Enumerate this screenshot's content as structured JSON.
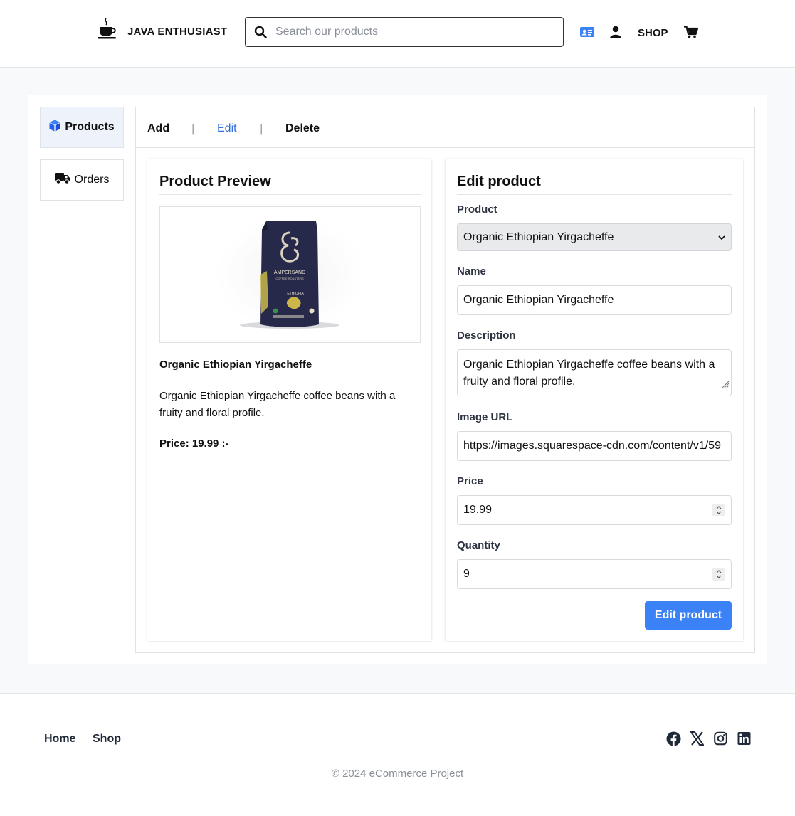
{
  "header": {
    "brand": "JAVA ENTHUSIAST",
    "search_placeholder": "Search our products",
    "shop_label": "SHOP",
    "icons": [
      "coffee-cup-icon",
      "search-icon",
      "id-card-icon",
      "user-icon",
      "cart-icon"
    ],
    "accent_color": "#3b82f6"
  },
  "sidebar": {
    "items": [
      {
        "label": "Products",
        "icon": "box-icon",
        "active": true
      },
      {
        "label": "Orders",
        "icon": "truck-icon",
        "active": false
      }
    ]
  },
  "tabs": [
    {
      "label": "Add",
      "active": false
    },
    {
      "label": "Edit",
      "active": true
    },
    {
      "label": "Delete",
      "active": false
    }
  ],
  "tab_separator": "|",
  "preview": {
    "title": "Product Preview",
    "name": "Organic Ethiopian Yirgacheffe",
    "description": "Organic Ethiopian Yirgacheffe coffee beans with a fruity and floral profile.",
    "price_text": "Price: 19.99 :-",
    "image_brand": "AMPERSAND",
    "image_subbrand": "COFFEE ROASTERS",
    "image_origin": "ETHIOPIA"
  },
  "form": {
    "title": "Edit product",
    "product_label": "Product",
    "product_selected": "Organic Ethiopian Yirgacheffe",
    "name_label": "Name",
    "name_value": "Organic Ethiopian Yirgacheffe",
    "description_label": "Description",
    "description_value": "Organic Ethiopian Yirgacheffe coffee beans with a fruity and floral profile.",
    "image_url_label": "Image URL",
    "image_url_value": "https://images.squarespace-cdn.com/content/v1/59",
    "price_label": "Price",
    "price_value": "19.99",
    "quantity_label": "Quantity",
    "quantity_value": "9",
    "submit_label": "Edit product"
  },
  "footer": {
    "links": [
      "Home",
      "Shop"
    ],
    "social_icons": [
      "facebook-icon",
      "x-icon",
      "instagram-icon",
      "linkedin-icon"
    ],
    "copyright": "© 2024 eCommerce Project"
  }
}
